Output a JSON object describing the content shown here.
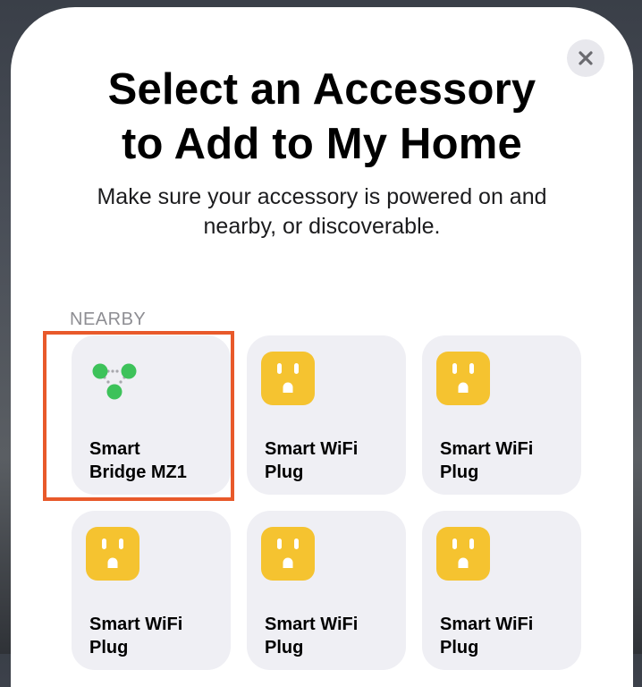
{
  "header": {
    "title_line1": "Select an Accessory",
    "title_line2": "to Add to My Home",
    "subtitle_line1": "Make sure your accessory is powered on and",
    "subtitle_line2": "nearby, or discoverable.",
    "close_icon": "close-icon"
  },
  "section": {
    "label": "NEARBY"
  },
  "accessories": [
    {
      "icon": "bridge-icon",
      "line1": "Smart",
      "line2": "Bridge MZ1",
      "selected": true
    },
    {
      "icon": "plug-icon",
      "line1": "Smart WiFi",
      "line2": "Plug",
      "selected": false
    },
    {
      "icon": "plug-icon",
      "line1": "Smart WiFi",
      "line2": "Plug",
      "selected": false
    },
    {
      "icon": "plug-icon",
      "line1": "Smart WiFi",
      "line2": "Plug",
      "selected": false
    },
    {
      "icon": "plug-icon",
      "line1": "Smart WiFi",
      "line2": "Plug",
      "selected": false
    },
    {
      "icon": "plug-icon",
      "line1": "Smart WiFi",
      "line2": "Plug",
      "selected": false
    }
  ],
  "colors": {
    "selection_highlight": "#e8592a",
    "plug_icon": "#f5c330",
    "bridge_node": "#3dc25a",
    "tile_background": "#efeff4"
  }
}
